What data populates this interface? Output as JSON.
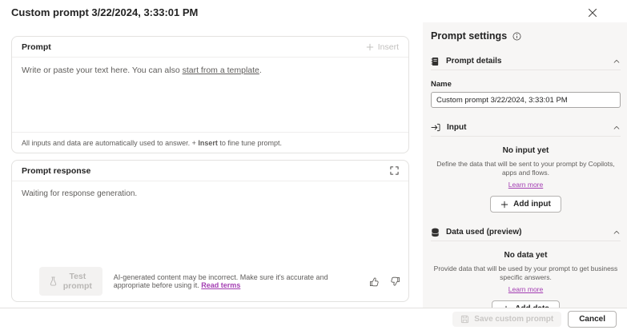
{
  "dialog": {
    "title": "Custom prompt 3/22/2024, 3:33:01 PM"
  },
  "prompt_card": {
    "header": "Prompt",
    "insert_label": "Insert",
    "placeholder_pre": "Write or paste your text here. You can also ",
    "placeholder_link": "start from a template",
    "placeholder_post": ".",
    "note_pre": "All inputs and data are automatically used to answer. + ",
    "note_bold": "Insert",
    "note_post": " to fine tune prompt."
  },
  "response_card": {
    "header": "Prompt response",
    "waiting_text": "Waiting for response generation.",
    "test_button_label": "Test prompt",
    "disclaimer": "AI-generated content may be incorrect. Make sure it's accurate and appropriate before using it. ",
    "read_terms_label": "Read terms"
  },
  "settings": {
    "title": "Prompt settings",
    "prompt_details": {
      "header": "Prompt details",
      "name_label": "Name",
      "name_value": "Custom prompt 3/22/2024, 3:33:01 PM"
    },
    "input": {
      "header": "Input",
      "empty_title": "No input yet",
      "empty_desc": "Define the data that will be sent to your prompt by Copilots, apps and flows.",
      "learn_more": "Learn more",
      "add_label": "Add input"
    },
    "data_used": {
      "header": "Data used (preview)",
      "empty_title": "No data yet",
      "empty_desc": "Provide data that will be used by your prompt to get business specific answers.",
      "learn_more": "Learn more",
      "add_label": "Add data"
    }
  },
  "footer": {
    "save_label": "Save custom prompt",
    "cancel_label": "Cancel"
  },
  "colors": {
    "link": "#a33db2",
    "panel_bg": "#f7f6f5",
    "disabled_text": "#c9c7c5",
    "secondary_text": "#5f5d5b"
  }
}
